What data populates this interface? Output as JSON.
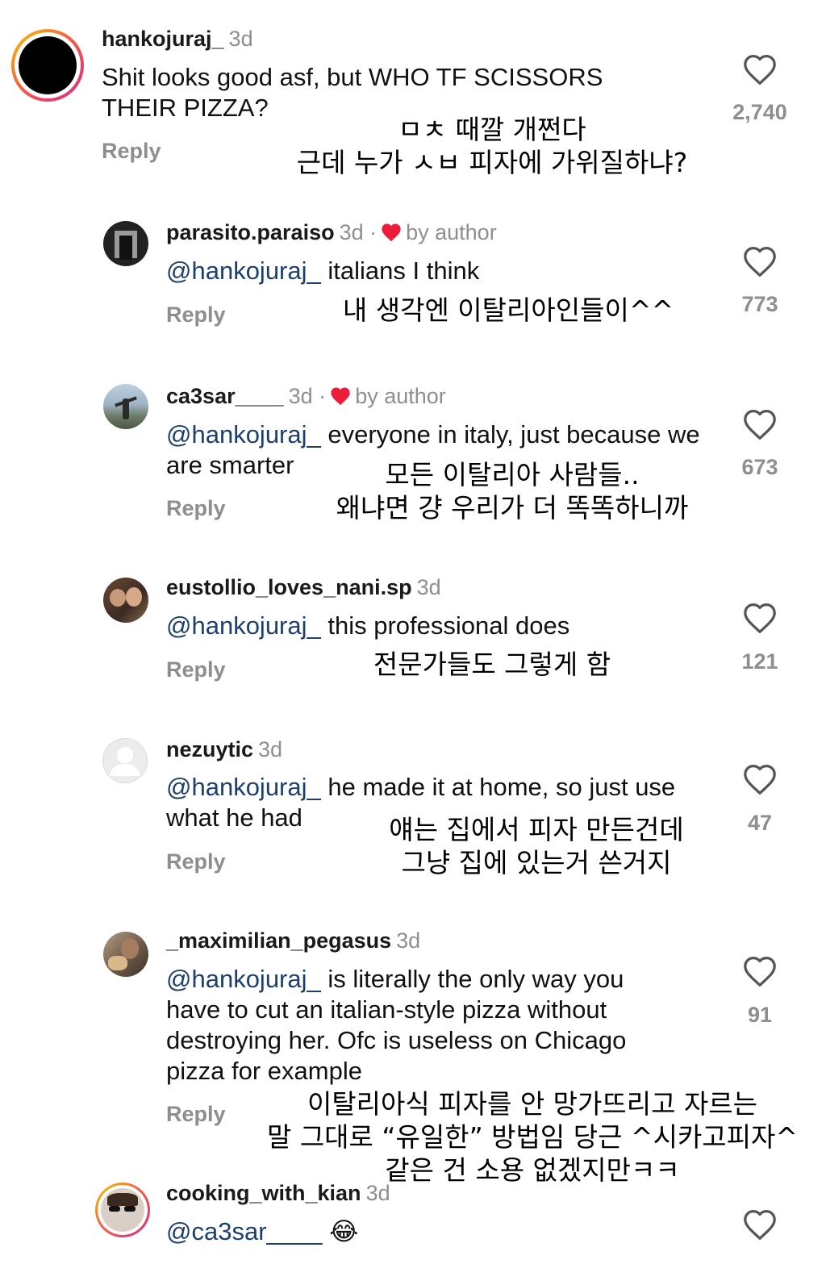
{
  "comments": [
    {
      "username": "hankojuraj_",
      "time": "3d",
      "text": "Shit looks good asf, but WHO TF SCISSORS THEIR PIZZA?",
      "likes": "2,740",
      "reply": "Reply",
      "translation": [
        "ㅁㅊ 때깔 개쩐다",
        "근데 누가 ㅅㅂ 피자에 가위질하냐?"
      ]
    },
    {
      "username": "parasito.paraiso",
      "time": "3d ·",
      "badge": "by author",
      "mention": "@hankojuraj_",
      "text": " italians I think",
      "likes": "773",
      "reply": "Reply",
      "translation": [
        "내 생각엔 이탈리아인들이^^"
      ]
    },
    {
      "username": "ca3sar____",
      "time": "3d ·",
      "badge": "by author",
      "mention": "@hankojuraj_",
      "text": " everyone in italy, just because we are smarter",
      "likes": "673",
      "reply": "Reply",
      "translation": [
        "모든 이탈리아 사람들..",
        "왜냐면 걍 우리가 더 똑똑하니까"
      ]
    },
    {
      "username": "eustollio_loves_nani.sp",
      "time": "3d",
      "mention": "@hankojuraj_",
      "text": " this professional does",
      "likes": "121",
      "reply": "Reply",
      "translation": [
        "전문가들도 그렇게 함"
      ]
    },
    {
      "username": "nezuytic",
      "time": "3d",
      "mention": "@hankojuraj_",
      "text": " he made it at home, so just use what he had",
      "likes": "47",
      "reply": "Reply",
      "translation": [
        "얘는 집에서 피자 만든건데",
        "그냥 집에 있는거 쓴거지"
      ]
    },
    {
      "username": "_maximilian_pegasus",
      "time": "3d",
      "mention": "@hankojuraj_",
      "text": " is literally the only way you have to cut an italian-style pizza without destroying her. Ofc is useless on Chicago pizza for example",
      "likes": "91",
      "reply": "Reply",
      "translation": [
        "이탈리아식 피자를 안 망가뜨리고 자르는",
        "말 그대로 “유일한” 방법임 당근 ^시카고피자^",
        "같은 건 소용 없겠지만ㅋㅋ"
      ]
    },
    {
      "username": "cooking_with_kian",
      "time": "3d",
      "mention": "@ca3sar____",
      "emoji": "😂"
    }
  ],
  "colors": {
    "mention": "#1d3f6e",
    "muted": "#8e8e8e",
    "heart_red": "#ed1c3a",
    "story_ring_start": "#f9c900",
    "story_ring_end": "#d62a8c"
  },
  "icons": [
    "heart-outline-icon",
    "heart-filled-icon",
    "default-avatar-icon",
    "laughing-emoji"
  ]
}
